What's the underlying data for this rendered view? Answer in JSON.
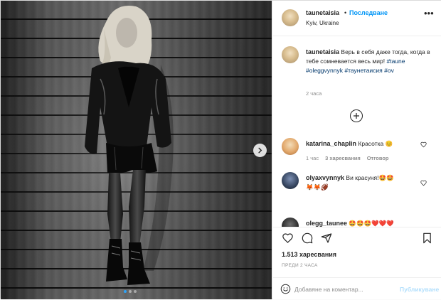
{
  "header": {
    "username": "taunetaisia",
    "separator": "•",
    "follow_label": "Последване",
    "location": "Kyiv, Ukraine",
    "more_icon": "more-icon"
  },
  "caption": {
    "username": "taunetaisia",
    "text": "Верь в себя даже тогда, когда в тебе сомневается весь мир!",
    "hashtags": [
      "#taune",
      "#oleggvynnyk",
      "#таунетаисия",
      "#ov"
    ],
    "time": "2 часа"
  },
  "comments": [
    {
      "username": "katarina_chaplin",
      "text": "Красотка 😊",
      "time": "1 час",
      "likes": "3 харесвания",
      "reply": "Отговор"
    },
    {
      "username": "olyaxvynnyk",
      "text": "Ви красуня!🤩🤩",
      "text2": "🦊🦊🏈",
      "time": "",
      "likes": "",
      "reply": ""
    },
    {
      "username": "olegg_taunee",
      "text": "🤩🤩🤩❤️❤️❤️",
      "time": "",
      "likes": "",
      "reply": ""
    }
  ],
  "footer": {
    "likes": "1.513 харесвания",
    "posted": "ПРЕДИ 2 ЧАСА",
    "comment_placeholder": "Добавяне на коментар...",
    "publish_label": "Публикуване"
  },
  "carousel": {
    "slides": 3,
    "active": 0
  },
  "colors": {
    "accent": "#0095f6",
    "link": "#00376b",
    "muted": "#8e8e8e",
    "publish_disabled": "#b2dffc"
  }
}
